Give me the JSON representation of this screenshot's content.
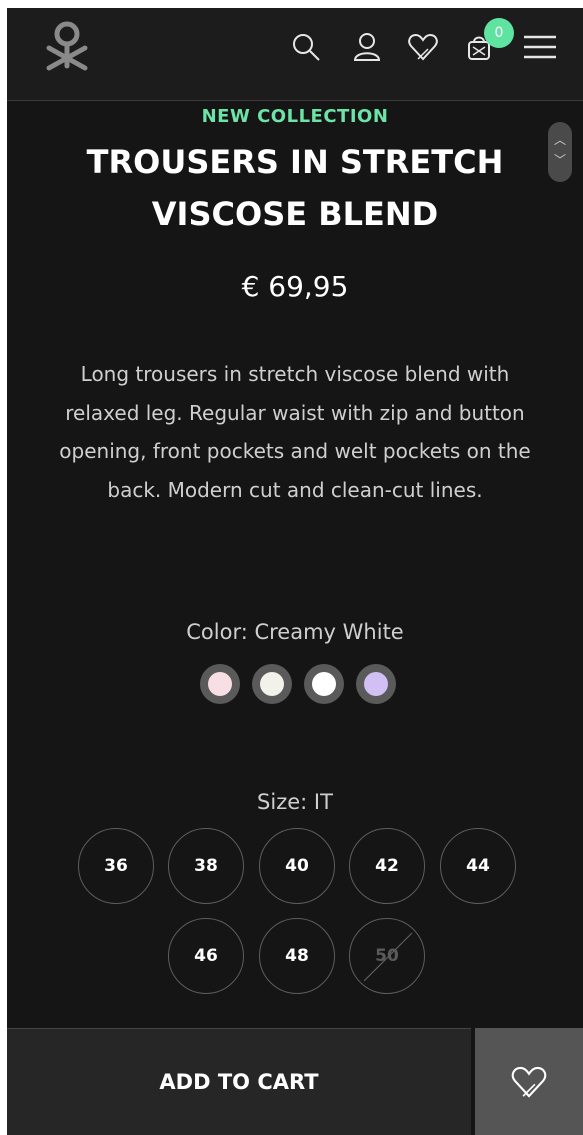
{
  "header": {
    "logo_icon": "benetton-logo",
    "icons": [
      "search-icon",
      "user-icon",
      "heart-icon",
      "bag-icon",
      "menu-icon"
    ],
    "cart_count": "0",
    "badge_color": "#5fe3a1"
  },
  "product": {
    "eyebrow": "NEW COLLECTION",
    "title": "TROUSERS IN STRETCH VISCOSE BLEND",
    "price": "€ 69,95",
    "description": "Long trousers in stretch viscose blend with relaxed leg. Regular waist with zip and button opening, front pockets and welt pockets on the back. Modern cut and clean-cut lines."
  },
  "color": {
    "label": "Color: Creamy White",
    "swatches": [
      {
        "name": "pink",
        "hex": "#f7dfe5"
      },
      {
        "name": "creamy-white",
        "hex": "#f3f2ea"
      },
      {
        "name": "white",
        "hex": "#ffffff"
      },
      {
        "name": "lilac",
        "hex": "#d2c0f5"
      }
    ]
  },
  "size": {
    "label": "Size: IT",
    "options": [
      {
        "label": "36",
        "available": true
      },
      {
        "label": "38",
        "available": true
      },
      {
        "label": "40",
        "available": true
      },
      {
        "label": "42",
        "available": true
      },
      {
        "label": "44",
        "available": true
      },
      {
        "label": "46",
        "available": true
      },
      {
        "label": "48",
        "available": true
      },
      {
        "label": "50",
        "available": false
      }
    ]
  },
  "actions": {
    "add_to_cart": "ADD TO CART",
    "wishlist_icon": "heart-icon"
  },
  "colors": {
    "background": "#151515",
    "accent": "#6ee3a7",
    "button_bg": "#262626",
    "wishlist_bg": "#555555"
  }
}
